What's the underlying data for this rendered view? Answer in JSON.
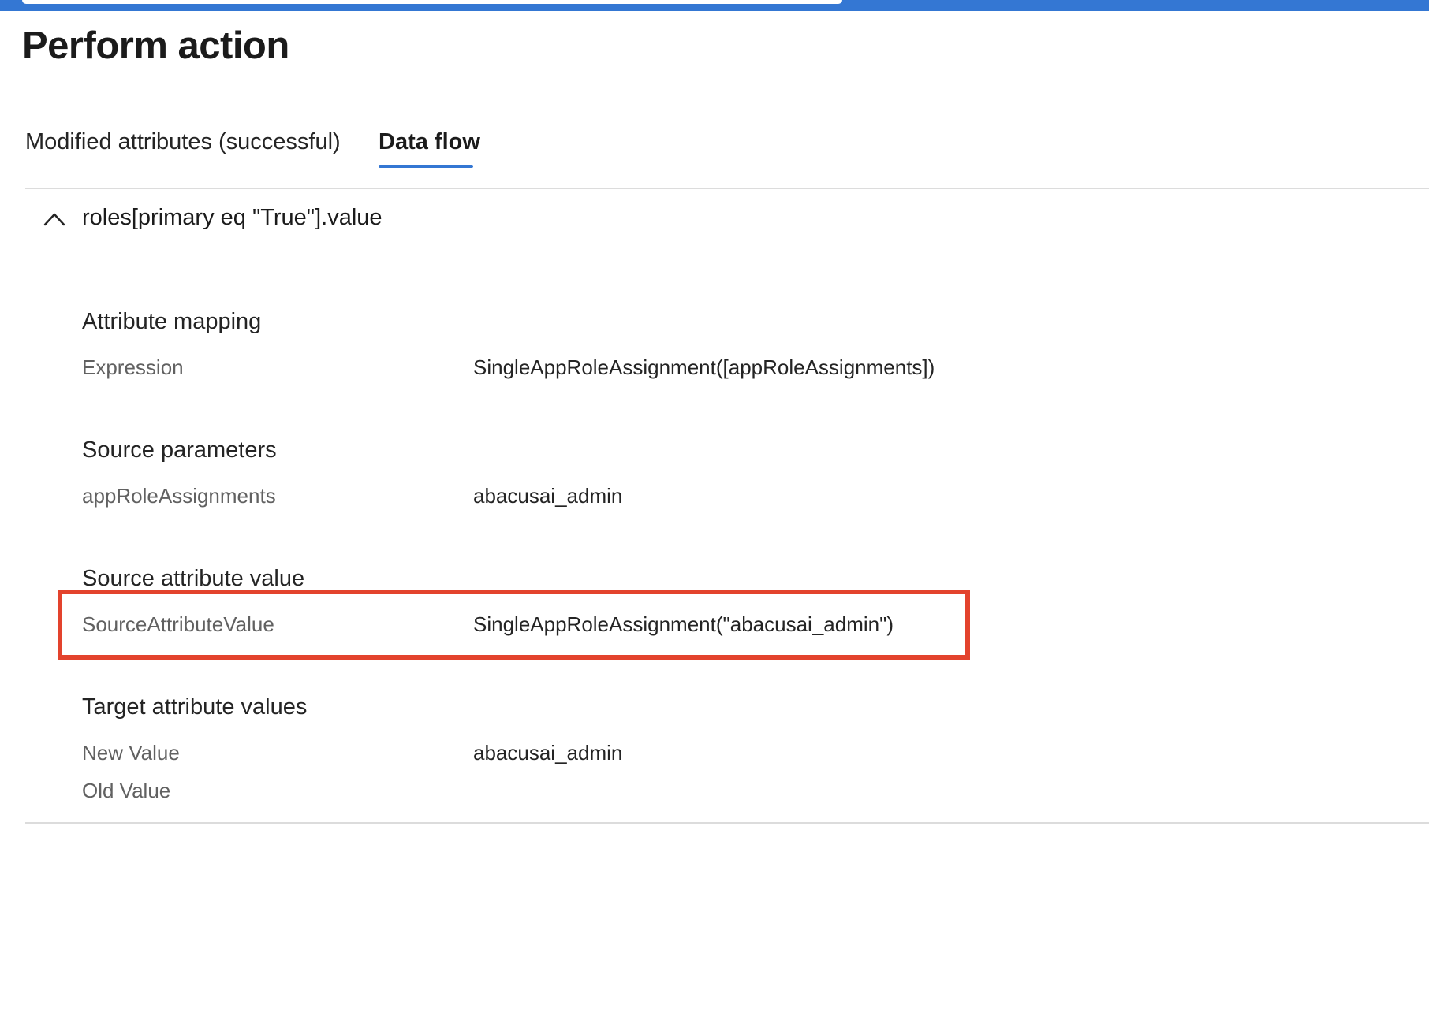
{
  "colors": {
    "accent": "#3477d3",
    "highlight": "#e3432d",
    "muted_text": "#616161"
  },
  "page": {
    "title": "Perform action"
  },
  "tabs": [
    {
      "label": "Modified attributes (successful)",
      "selected": false
    },
    {
      "label": "Data flow",
      "selected": true
    }
  ],
  "section": {
    "title": "roles[primary eq \"True\"].value",
    "expanded": true,
    "icon": "chevron-up-icon"
  },
  "attribute_mapping": {
    "heading": "Attribute mapping",
    "expression_label": "Expression",
    "expression_value": "SingleAppRoleAssignment([appRoleAssignments])"
  },
  "source_parameters": {
    "heading": "Source parameters",
    "param_label": "appRoleAssignments",
    "param_value": "abacusai_admin"
  },
  "source_attribute_value": {
    "heading": "Source attribute value",
    "label": "SourceAttributeValue",
    "value": "SingleAppRoleAssignment(\"abacusai_admin\")",
    "highlighted": true
  },
  "target_attribute_values": {
    "heading": "Target attribute values",
    "new_value_label": "New Value",
    "new_value": "abacusai_admin",
    "old_value_label": "Old Value",
    "old_value": ""
  }
}
